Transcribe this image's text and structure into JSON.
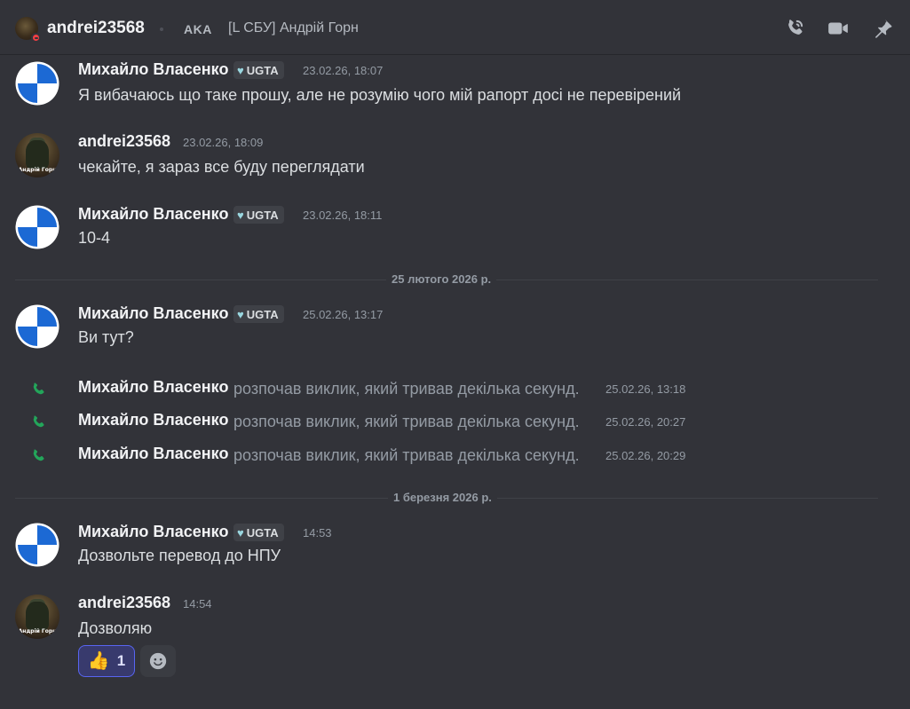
{
  "header": {
    "username": "andrei23568",
    "aka_label": "AKA",
    "nickname": "[L СБУ] Андрій Горн",
    "icons": [
      "voice-call-icon",
      "video-call-icon",
      "pin-icon"
    ]
  },
  "colors": {
    "background": "#323339",
    "call_icon": "#23a55a",
    "reaction_border": "#5865f2",
    "dnd_status": "#f23f43",
    "tag_heart": "#9ad7e0"
  },
  "messages": [
    {
      "author": "Михайло Власенко",
      "tag": "UGTA",
      "timestamp": "23.02.26, 18:07",
      "text": "Я вибачаюсь що таке прошу, але не розумію чого мій рапорт досі не перевірений"
    },
    {
      "author": "andrei23568",
      "avatar_caption": "Андрій Горн",
      "timestamp": "23.02.26, 18:09",
      "text": "чекайте, я зараз все буду переглядати"
    },
    {
      "author": "Михайло Власенко",
      "tag": "UGTA",
      "timestamp": "23.02.26, 18:11",
      "text": "10-4"
    },
    {
      "author": "Михайло Власенко",
      "tag": "UGTA",
      "timestamp": "25.02.26, 13:17",
      "text": "Ви тут?"
    },
    {
      "author": "Михайло Власенко",
      "tag": "UGTA",
      "timestamp": "14:53",
      "text": "Дозвольте перевод до НПУ"
    },
    {
      "author": "andrei23568",
      "avatar_caption": "Андрій Горн",
      "timestamp": "14:54",
      "text": "Дозволяю"
    }
  ],
  "dividers": [
    "25 лютого 2026 р.",
    "1 березня 2026 р."
  ],
  "calls": [
    {
      "author": "Михайло Власенко",
      "text": "розпочав виклик, який тривав декілька секунд.",
      "timestamp": "25.02.26, 13:18"
    },
    {
      "author": "Михайло Власенко",
      "text": "розпочав виклик, який тривав декілька секунд.",
      "timestamp": "25.02.26, 20:27"
    },
    {
      "author": "Михайло Власенко",
      "text": "розпочав виклик, який тривав декілька секунд.",
      "timestamp": "25.02.26, 20:29"
    }
  ],
  "reaction": {
    "emoji": "👍",
    "count": "1"
  }
}
